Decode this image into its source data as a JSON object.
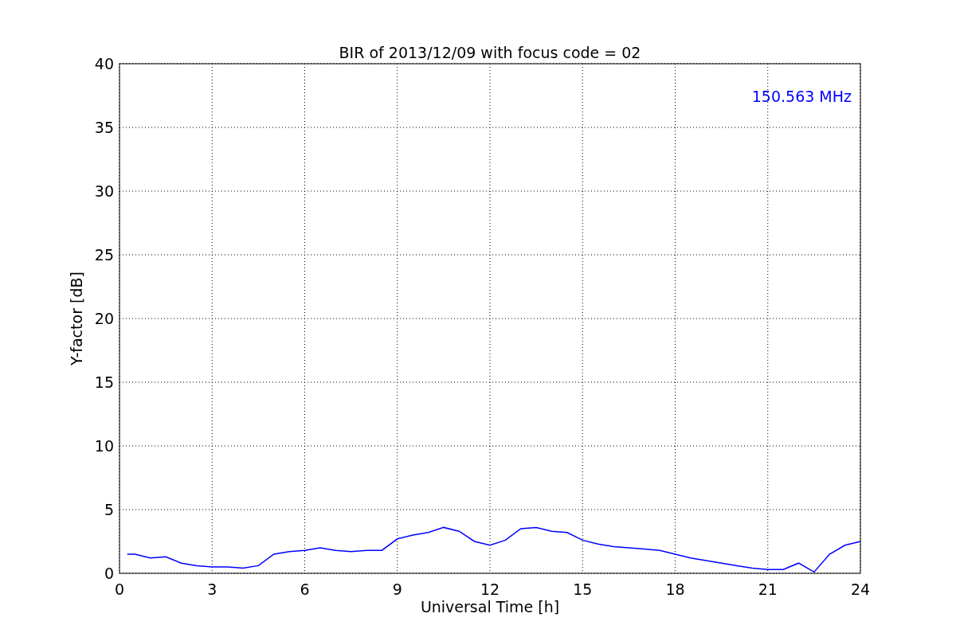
{
  "chart_data": {
    "type": "line",
    "title": "BIR of 2013/12/09 with focus code = 02",
    "xlabel": "Universal Time [h]",
    "ylabel": "Y-factor [dB]",
    "x": [
      0.25,
      0.5,
      1,
      1.5,
      2,
      2.5,
      3,
      3.5,
      4,
      4.5,
      5,
      5.5,
      6,
      6.5,
      7,
      7.5,
      8,
      8.5,
      9,
      9.5,
      10,
      10.5,
      11,
      11.5,
      12,
      12.5,
      13,
      13.5,
      14,
      14.5,
      15,
      15.5,
      16,
      16.5,
      17,
      17.5,
      18,
      18.5,
      19,
      19.5,
      20,
      20.5,
      21,
      21.5,
      22,
      22.5,
      23,
      23.5,
      24
    ],
    "series": [
      {
        "name": "150.563 MHz",
        "color": "#0000ff",
        "values": [
          1.5,
          1.5,
          1.2,
          1.3,
          0.8,
          0.6,
          0.5,
          0.5,
          0.4,
          0.6,
          1.5,
          1.7,
          1.8,
          2.0,
          1.8,
          1.7,
          1.8,
          1.8,
          2.7,
          3.0,
          3.2,
          3.6,
          3.3,
          2.5,
          2.2,
          2.6,
          3.5,
          3.6,
          3.3,
          3.2,
          2.6,
          2.3,
          2.1,
          2.0,
          1.9,
          1.8,
          1.5,
          1.2,
          1.0,
          0.8,
          0.6,
          0.4,
          0.3,
          0.3,
          0.8,
          0.1,
          1.5,
          2.2,
          2.5
        ]
      }
    ],
    "xlim": [
      0,
      24
    ],
    "ylim": [
      0,
      40
    ],
    "xticks": [
      0,
      3,
      6,
      9,
      12,
      15,
      18,
      21,
      24
    ],
    "yticks": [
      0,
      5,
      10,
      15,
      20,
      25,
      30,
      35,
      40
    ],
    "grid": true
  }
}
